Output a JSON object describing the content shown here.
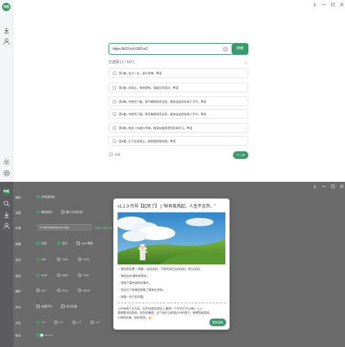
{
  "app": {
    "logo_text": "哔哩",
    "accent_color": "#3a9a6c"
  },
  "sidebar": {
    "top_icons": [
      "search-icon",
      "download-icon",
      "user-icon"
    ],
    "bottom_icons": [
      "sun-icon",
      "gear-icon"
    ]
  },
  "window_controls": [
    "pin-icon",
    "minimize-icon",
    "maximize-icon",
    "close-icon"
  ],
  "parse": {
    "url_value": "https://b23.tv/VSR1rn2",
    "clear_symbol": "×",
    "parse_label": "搜索"
  },
  "selection": {
    "label": "已选择 [ 1 / 107 ]",
    "chevron": "⌄"
  },
  "episodes": [
    "第1集 | 宝刀一出，谁与争锋。粤语",
    "第2集 | 张翠山，铁划银钩，强敌压阵用好。粤语",
    "第3集 | 你绝世门槛，那不着瞬息家宝家。要来连该到张翠人手中。粤语",
    "第4集 | 你绝世门槛，那不着瞬息家宝家。要来连该到张翠人手中。粤语",
    "第5集 | 相关一如者与争锋，献宠有着两得到张翠学习。粤语",
    "第6集 | 左下拉张翠山，铁划银钩是有镜。粤语"
  ],
  "footer": {
    "select_all": "全选",
    "next_label": "下一步"
  },
  "settings": {
    "rows": [
      {
        "label": "通知",
        "options": [
          {
            "text": "系统通知者",
            "on": true
          }
        ]
      },
      {
        "label": "流量",
        "options": [
          {
            "text": "播放顺序",
            "on": true
          },
          {
            "text": "最小化到托盘",
            "on": false
          }
        ]
      },
      {
        "label": "存储",
        "path": "K:\\BiliAlbilibiliDownload",
        "link": "目录  打开目录"
      },
      {
        "label": "剧集",
        "options": [
          {
            "text": "封面",
            "on": true
          },
          {
            "text": "音色",
            "on": true
          },
          {
            "text": "XML弹幕",
            "on": false
          }
        ]
      },
      {
        "label": "音质",
        "options": [
          {
            "text": "64K",
            "on": true
          },
          {
            "text": "132K",
            "on": false
          },
          {
            "text": "192K",
            "on": false
          }
        ]
      },
      {
        "label": "画质",
        "options": [
          {
            "text": "360P",
            "on": true
          },
          {
            "text": "480P",
            "on": false
          },
          {
            "text": "720P",
            "on": false
          }
        ]
      },
      {
        "label": "编码",
        "options": [
          {
            "text": "AVC",
            "on": false
          },
          {
            "text": "AV01",
            "on": false
          },
          {
            "text": "HEVC",
            "on": false
          }
        ]
      },
      {
        "label": "命名",
        "options": [
          {
            "text": "前置序号",
            "on": false
          },
          {
            "text": "系列标题",
            "on": false
          }
        ]
      },
      {
        "label": "并发",
        "options": [
          {
            "text": "1个",
            "on": true
          },
          {
            "text": "2个",
            "on": false
          },
          {
            "text": "3个",
            "on": false
          },
          {
            "text": "4个",
            "on": false
          }
        ]
      },
      {
        "label": "版本",
        "options": [
          {
            "text": "v1.1.3",
            "on": true
          }
        ]
      }
    ]
  },
  "modal": {
    "title": "v1.1.3 代号【起风了】 | \"纵有疾风起，人生不言弃。\"",
    "changes": [
      "♢ 增加到设置 > 弹幕 > 自动关机。下载完成后自动关机。默认关闭。",
      "♢ 增加支持 解析新版本。",
      "♢ 修复下载完成时时事件。",
      "♢ 优化左下角增加到推了载来生进码。",
      "♢ 修复一些已知问题。"
    ],
    "note_lines": [
      "心中有两个天万话，但手机就会错误上 翻译一个字它打不过来(ง ˙o˙)ว",
      "我想要如同身体，因为的事情，这个软件当前我心中的两子，希望您能喜欢。",
      "小闻的作者，很好很快。👍"
    ],
    "ok_label": "我知道啦"
  }
}
